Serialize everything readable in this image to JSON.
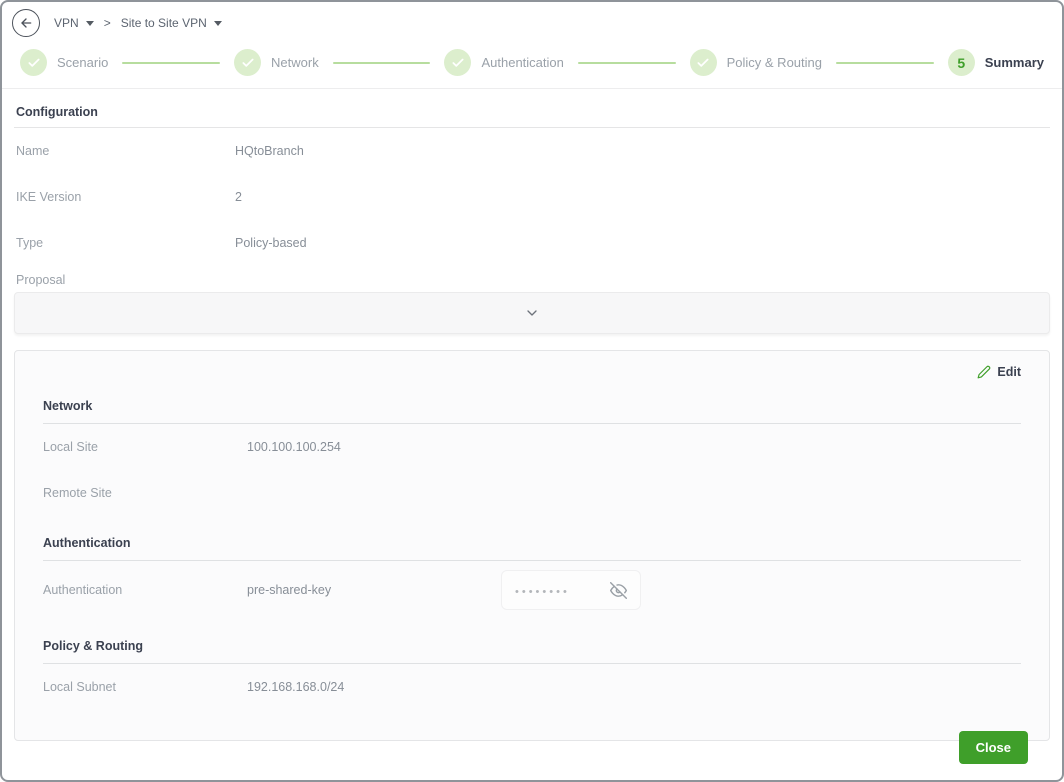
{
  "colors": {
    "accent_green": "#3f9f2a",
    "step_circle_green": "#dceecd",
    "connector_green": "#b7dd9e",
    "heading_dark": "#3b4150",
    "label_gray": "#9aa1a9"
  },
  "topbar": {
    "back_icon": "arrow-left-icon",
    "breadcrumb": {
      "root": "VPN",
      "separator": ">",
      "current": "Site to Site VPN"
    }
  },
  "stepper": {
    "steps": [
      {
        "label": "Scenario",
        "state": "done"
      },
      {
        "label": "Network",
        "state": "done"
      },
      {
        "label": "Authentication",
        "state": "done"
      },
      {
        "label": "Policy & Routing",
        "state": "done"
      },
      {
        "label": "Summary",
        "state": "current",
        "number": "5"
      }
    ]
  },
  "configuration": {
    "title": "Configuration",
    "rows": [
      {
        "label": "Name",
        "value": "HQtoBranch"
      },
      {
        "label": "IKE Version",
        "value": "2"
      },
      {
        "label": "Type",
        "value": "Policy-based"
      }
    ],
    "proposal": {
      "label": "Proposal",
      "collapse_icon": "chevron-down-icon"
    }
  },
  "summary": {
    "edit_label": "Edit",
    "network": {
      "title": "Network",
      "local_site_label": "Local Site",
      "local_site_value": "100.100.100.254",
      "remote_site_label": "Remote Site",
      "remote_site_value": ""
    },
    "authentication": {
      "title": "Authentication",
      "label": "Authentication",
      "value": "pre-shared-key",
      "password_mask": "••••••••"
    },
    "policy_routing": {
      "title": "Policy & Routing",
      "local_subnet_label": "Local Subnet",
      "local_subnet_value": "192.168.168.0/24"
    }
  },
  "footer": {
    "close_label": "Close"
  }
}
